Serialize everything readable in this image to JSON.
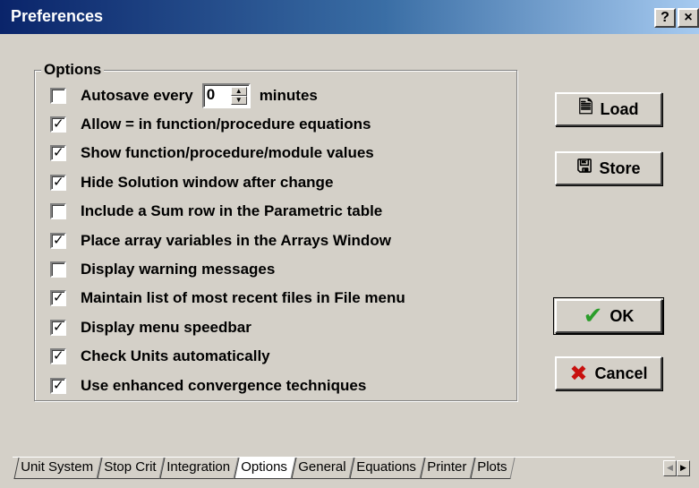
{
  "window": {
    "title": "Preferences",
    "help_label": "?",
    "close_label": "×"
  },
  "options_group": {
    "legend": "Options",
    "autosave": {
      "checked": false,
      "label_before": "Autosave every",
      "value": "0",
      "label_after": "minutes"
    },
    "items": [
      {
        "label": "Allow = in function/procedure equations",
        "checked": true
      },
      {
        "label": "Show function/procedure/module values",
        "checked": true
      },
      {
        "label": "Hide Solution window after change",
        "checked": true
      },
      {
        "label": "Include a Sum row in the Parametric table",
        "checked": false
      },
      {
        "label": "Place array variables in the Arrays Window",
        "checked": true
      },
      {
        "label": "Display warning messages",
        "checked": false
      },
      {
        "label": "Maintain list of most recent files in File menu",
        "checked": true
      },
      {
        "label": "Display menu speedbar",
        "checked": true
      },
      {
        "label": "Check Units automatically",
        "checked": true
      },
      {
        "label": "Use enhanced convergence techniques",
        "checked": true
      }
    ]
  },
  "buttons": {
    "load": "Load",
    "store": "Store",
    "ok": "OK",
    "cancel": "Cancel"
  },
  "icons": {
    "load": "document-icon",
    "store": "save-to-disk-icon",
    "ok": "green-checkmark-icon",
    "cancel": "red-x-icon"
  },
  "tabs": [
    {
      "label": "Unit System",
      "active": false
    },
    {
      "label": "Stop Crit",
      "active": false
    },
    {
      "label": "Integration",
      "active": false
    },
    {
      "label": "Options",
      "active": true
    },
    {
      "label": "General",
      "active": false
    },
    {
      "label": "Equations",
      "active": false
    },
    {
      "label": "Printer",
      "active": false
    },
    {
      "label": "Plots",
      "active": false
    }
  ],
  "colors": {
    "title_start": "#0a246a",
    "title_end": "#a6caf0",
    "face": "#d4d0c8",
    "ok_check": "#2a9d2a",
    "cancel_x": "#c8100e"
  }
}
